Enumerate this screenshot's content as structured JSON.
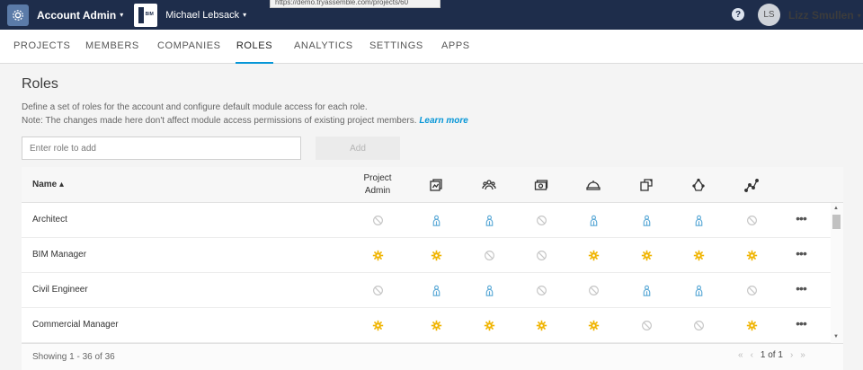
{
  "topbar": {
    "account_label": "Account Admin",
    "project_name": "Michael Lebsack",
    "project_logo_text": "BIM",
    "url_tooltip": "https://demo.tryassemble.com/projects/60",
    "help_label": "?",
    "user_initials": "LS",
    "user_name": "Lizz Smullen",
    "caret": "▾"
  },
  "nav": {
    "tabs": [
      {
        "label": "PROJECTS"
      },
      {
        "label": "MEMBERS"
      },
      {
        "label": "COMPANIES"
      },
      {
        "label": "ROLES"
      },
      {
        "label": "ANALYTICS"
      },
      {
        "label": "SETTINGS"
      },
      {
        "label": "APPS"
      }
    ],
    "active": "ROLES"
  },
  "page": {
    "title": "Roles",
    "desc_line1": "Define a set of roles for the account and configure default module access for each role.",
    "desc_line2": "Note: The changes made here don't affect module access permissions of existing project members.",
    "learn_more": "Learn more"
  },
  "form": {
    "placeholder": "Enter role to add",
    "add_label": "Add"
  },
  "table": {
    "name_header": "Name ▴",
    "project_admin_header_1": "Project",
    "project_admin_header_2": "Admin",
    "module_icons": [
      "docs-icon",
      "team-icon",
      "cost-icon",
      "field-icon",
      "design-icon",
      "insight-icon",
      "graph-icon"
    ],
    "rows": [
      {
        "name": "Architect",
        "cells": [
          "none",
          "user",
          "user",
          "none",
          "user",
          "user",
          "user",
          "none"
        ]
      },
      {
        "name": "BIM Manager",
        "cells": [
          "admin",
          "admin",
          "none",
          "none",
          "admin",
          "admin",
          "admin",
          "admin"
        ]
      },
      {
        "name": "Civil Engineer",
        "cells": [
          "none",
          "user",
          "user",
          "none",
          "none",
          "user",
          "user",
          "none"
        ]
      },
      {
        "name": "Commercial Manager",
        "cells": [
          "admin",
          "admin",
          "admin",
          "admin",
          "admin",
          "none",
          "none",
          "admin"
        ]
      }
    ],
    "more_label": "•••",
    "showing": "Showing 1 - 36 of 36",
    "page": "1 of 1"
  },
  "colors": {
    "topbar": "#1e2d4b",
    "accent": "#0696d7",
    "admin": "#f0b400",
    "user": "#5aa9d6",
    "none": "#c6c6c6"
  }
}
